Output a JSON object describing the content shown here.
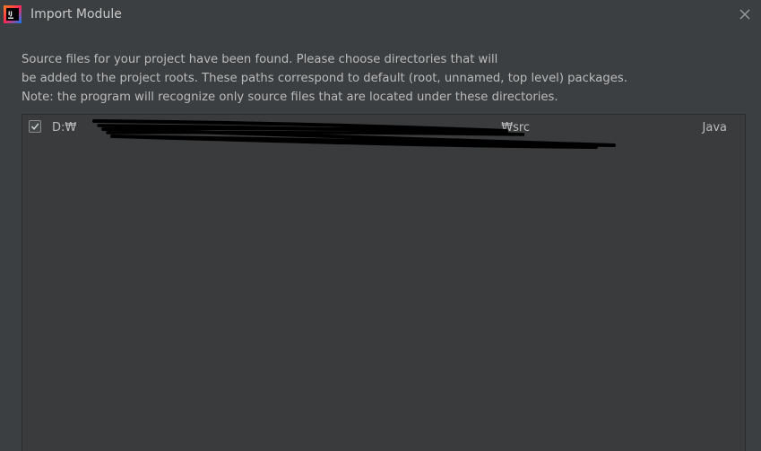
{
  "window": {
    "title": "Import Module",
    "app_icon": "intellij-idea-icon",
    "close_icon": "close-icon"
  },
  "message": {
    "line1": "Source files for your project have been found. Please choose directories that will",
    "line2": "be added to the project roots. These paths correspond to default (root, unnamed, top level) packages.",
    "line3": "Note: the program will recognize only source files that are located under these directories."
  },
  "source_roots": [
    {
      "checked": true,
      "path": "D:₩",
      "path_suffix": "₩src",
      "language": "Java"
    }
  ],
  "colors": {
    "background": "#3c3f41",
    "panel": "#393b3d",
    "text": "#bbbbbb",
    "redaction": "#000000"
  }
}
